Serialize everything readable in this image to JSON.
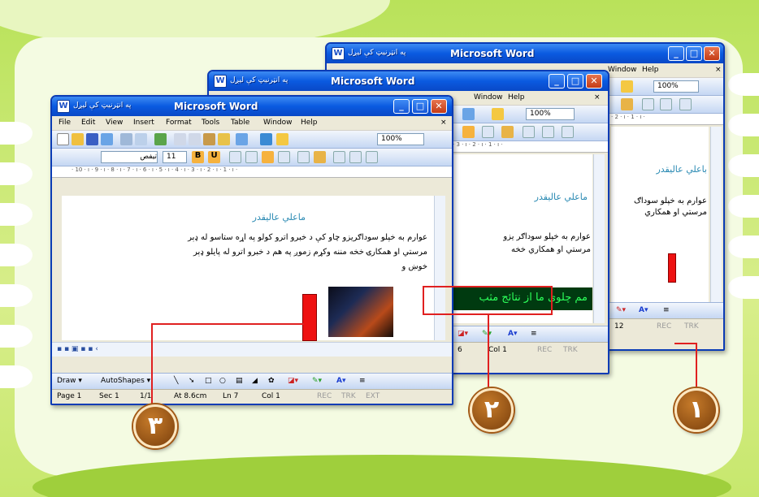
{
  "windows": {
    "back": {
      "app_title": "Microsoft Word",
      "doc_title": "په انټرنیټ کې لیږل",
      "menu": [
        "Window",
        "Help"
      ],
      "zoom": "100%",
      "heading": "باعلي عالیقدر",
      "body_lines": [
        "عوارم به خپلو سوداګ",
        "مرستي او همکاري"
      ],
      "status": {
        "col": "12",
        "rec": "REC",
        "trk": "TRK"
      }
    },
    "middle": {
      "app_title": "Microsoft Word",
      "doc_title": "په انټرنیټ کې لیږل",
      "menu": [
        "Window",
        "Help"
      ],
      "zoom": "100%",
      "heading": "ماعلي عالیقدر",
      "body_lines": [
        "عوارم به خپلو سوداګر یزو",
        "مرستي او همکاري خخه"
      ],
      "green_text": "مم چلوی ما از نتائج مثب",
      "status": {
        "page": "6",
        "col": "Col 1",
        "rec": "REC",
        "trk": "TRK"
      }
    },
    "front": {
      "app_title": "Microsoft Word",
      "doc_title": "په انټرنیټ کې لیږل",
      "menu": [
        "File",
        "Edit",
        "View",
        "Insert",
        "Format",
        "Tools",
        "Table",
        "Window",
        "Help"
      ],
      "zoom": "100%",
      "font_name": "تیفص",
      "font_size": "11",
      "heading": "ماعلي عالیقدر",
      "body_lines": [
        "عوارم به خپلو سوداګریزو چاو کې د خبرو اترو کولو په اړه ستاسو له ډېر",
        "مرستي او همکارۍ خخه مننه وکړم زموږ په هم د خبرو اترو له پایلو ډېر",
        "خوښ و"
      ],
      "drawbar": {
        "draw": "Draw ▾",
        "autoshapes": "AutoShapes ▾"
      },
      "status": {
        "page": "Page 1",
        "sec": "Sec 1",
        "pages": "1/1",
        "at": "At 8.6cm",
        "ln": "Ln 7",
        "col": "Col 1",
        "rec": "REC",
        "trk": "TRK",
        "ext": "EXT"
      }
    }
  },
  "callouts": {
    "one": "١",
    "two": "٢",
    "three": "٣"
  },
  "colors": {
    "title_blue": "#0a5ae0",
    "callout_red": "#e02020",
    "badge_brown": "#9b5718"
  }
}
